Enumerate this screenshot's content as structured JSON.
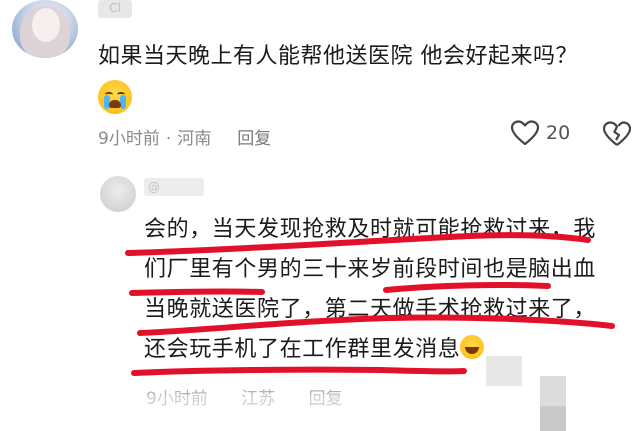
{
  "comment1": {
    "username": "Cl",
    "text": "如果当天晚上有人能帮他送医院  他会好起来吗？",
    "emoji": "loudly-crying-face",
    "time": "9小时前",
    "location": "河南",
    "reply_label": "回复",
    "like_count": "20"
  },
  "comment2": {
    "username": "@",
    "lines": [
      "会的，当天发现抢救及时就可能抢救过来，我",
      "们厂里有个男的三十来岁前段时间也是脑出血",
      "当晚就送医院了，第二天做手术抢救过来了，",
      "还会玩手机了在工作群里发消息"
    ],
    "emoji": "laughing-face",
    "time": "9小时前",
    "location": "江苏",
    "reply_label": "回复"
  },
  "colors": {
    "annotation_red": "#e3102a",
    "meta_gray": "#8a8a8a"
  }
}
